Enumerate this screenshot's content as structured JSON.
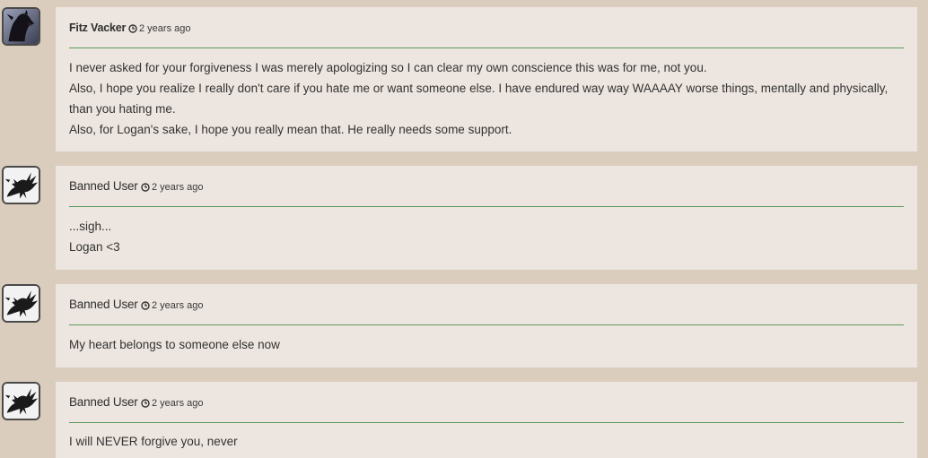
{
  "comments": [
    {
      "author": "Fitz Vacker",
      "time": "2 years ago",
      "avatar": "dark-dragon-avatar",
      "lines": [
        "I never asked for your forgiveness I was merely apologizing so I can clear my own conscience this was for me, not you.",
        "Also, I hope you realize I really don't care if you hate me or want someone else. I have endured way way WAAAAY worse things, mentally and physically, than you hating me.",
        "Also, for Logan's sake, I hope you really mean that. He really needs some support."
      ]
    },
    {
      "author": "Banned User",
      "time": "2 years ago",
      "avatar": "dragon-silhouette-avatar",
      "lines": [
        "...sigh...",
        "Logan <3"
      ]
    },
    {
      "author": "Banned User",
      "time": "2 years ago",
      "avatar": "dragon-silhouette-avatar",
      "lines": [
        "My heart belongs to someone else now"
      ]
    },
    {
      "author": "Banned User",
      "time": "2 years ago",
      "avatar": "dragon-silhouette-avatar",
      "lines": [
        "I will NEVER forgive you, never"
      ]
    }
  ],
  "colors": {
    "page_background": "#dacdbd",
    "card_background": "#ede5df",
    "divider": "#5a9a5a"
  }
}
